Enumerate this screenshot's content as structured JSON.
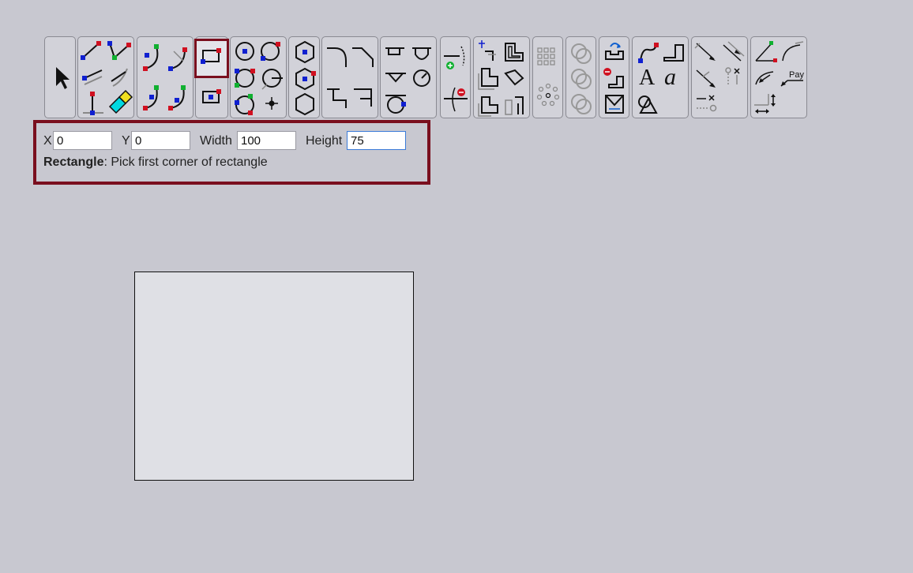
{
  "toolbar": {
    "groups": [
      {
        "name": "select",
        "icons": [
          "select-arrow-icon"
        ]
      },
      {
        "name": "lines",
        "icons": [
          "line-2pt-icon",
          "line-angle-icon",
          "line-parallel-icon",
          "line-tangent-icon",
          "line-perpendicular-icon",
          "eraser-pencil-icon"
        ]
      },
      {
        "name": "arcs",
        "icons": [
          "arc-3pt-icon",
          "arc-tangent-icon",
          "arc-center-icon",
          "arc-end-icon"
        ]
      },
      {
        "name": "rectangles",
        "icons": [
          "rectangle-corner-icon",
          "rectangle-center-icon"
        ]
      },
      {
        "name": "circles",
        "icons": [
          "circle-center-icon",
          "circle-2pt-icon",
          "circle-3pt-icon",
          "circle-radius-icon",
          "circle-tangent-icon",
          "point-icon"
        ]
      },
      {
        "name": "polygons",
        "icons": [
          "hexagon-center-icon",
          "hexagon-vertex-icon",
          "hexagon-edge-icon"
        ]
      },
      {
        "name": "fillets",
        "icons": [
          "fillet-icon",
          "chamfer-icon",
          "corner-trim-icon",
          "corner-extend-icon"
        ]
      },
      {
        "name": "slots",
        "icons": [
          "slot-straight-icon",
          "slot-arc-icon",
          "slot-vee-icon",
          "keyhole-icon",
          "circle-tangent-line-icon"
        ]
      },
      {
        "name": "trim",
        "icons": [
          "extend-add-icon",
          "trim-remove-icon"
        ]
      },
      {
        "name": "offsets",
        "icons": [
          "offset-corner-icon",
          "offset-shape-icon",
          "offset-copy-icon",
          "offset-bend-icon",
          "offset-step-icon",
          "offset-slot-icon"
        ]
      },
      {
        "name": "patterns",
        "icons": [
          "grid-pattern-icon",
          "circular-pattern-icon"
        ]
      },
      {
        "name": "booleans",
        "icons": [
          "union-icon",
          "intersect-icon",
          "subtract-icon"
        ]
      },
      {
        "name": "edit",
        "icons": [
          "move-icon",
          "delete-step-icon",
          "mirror-icon"
        ]
      },
      {
        "name": "text",
        "icons": [
          "spline-icon",
          "pipe-icon",
          "text-a-icon",
          "text-script-icon",
          "shape-overlap-icon"
        ]
      },
      {
        "name": "dimensions",
        "icons": [
          "dim-linear-icon",
          "dim-aligned-icon",
          "dim-angle-icon",
          "dim-point-icon",
          "dim-horizontal-icon",
          "dim-break-icon"
        ]
      },
      {
        "name": "annotations",
        "icons": [
          "angle-icon",
          "radius-icon",
          "arc-length-icon",
          "leader-pay-icon",
          "dim-vertical-icon",
          "dim-extend-icon"
        ]
      }
    ],
    "selected_tool": "rectangle-corner-icon",
    "leader_text": "Pay"
  },
  "command_panel": {
    "x_label": "X",
    "x_value": "0",
    "y_label": "Y",
    "y_value": "0",
    "width_label": "Width",
    "width_value": "100",
    "height_label": "Height",
    "height_value": "75",
    "command_name": "Rectangle",
    "command_prompt": ": Pick first corner of rectangle"
  },
  "canvas": {
    "shapes": [
      "rectangle"
    ]
  },
  "colors": {
    "background": "#c8c8d0",
    "accent_border": "#7a0f1e",
    "point_red": "#d01020",
    "point_blue": "#1020d0",
    "point_green": "#10b030"
  }
}
